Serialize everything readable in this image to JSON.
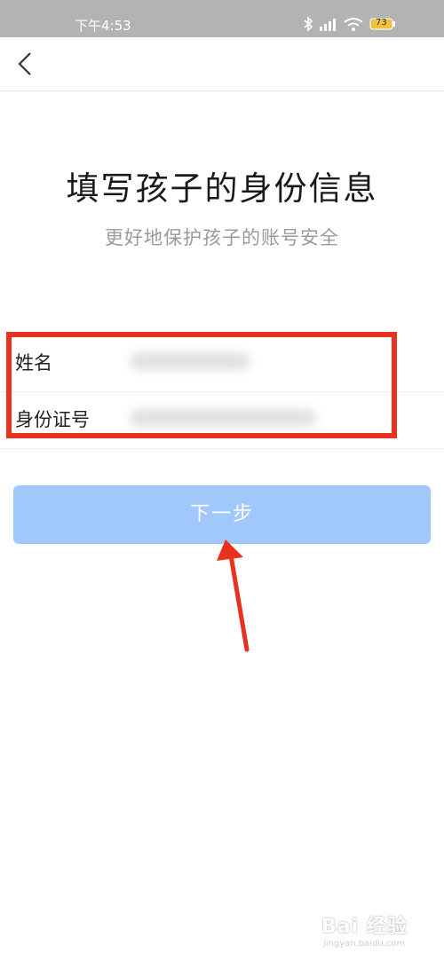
{
  "status_bar": {
    "time": "下午4:53",
    "battery": "73",
    "icons": [
      "bluetooth-icon",
      "signal-icon",
      "wifi-icon",
      "battery-icon"
    ]
  },
  "nav": {
    "back_icon": "chevron-left-icon"
  },
  "page": {
    "title": "填写孩子的身份信息",
    "subtitle": "更好地保护孩子的账号安全"
  },
  "form": {
    "name_label": "姓名",
    "id_label": "身份证号"
  },
  "buttons": {
    "next_label": "下一步"
  },
  "annotation": {
    "box_color": "#e8321e",
    "arrow_color": "#e8321e"
  },
  "colors": {
    "button_bg": "#a1c8fa",
    "title": "#1a1a1a",
    "subtitle": "#9a9a9a"
  },
  "watermark": {
    "text": "Bai 经验",
    "sub": "jingyan.baidu.com"
  }
}
